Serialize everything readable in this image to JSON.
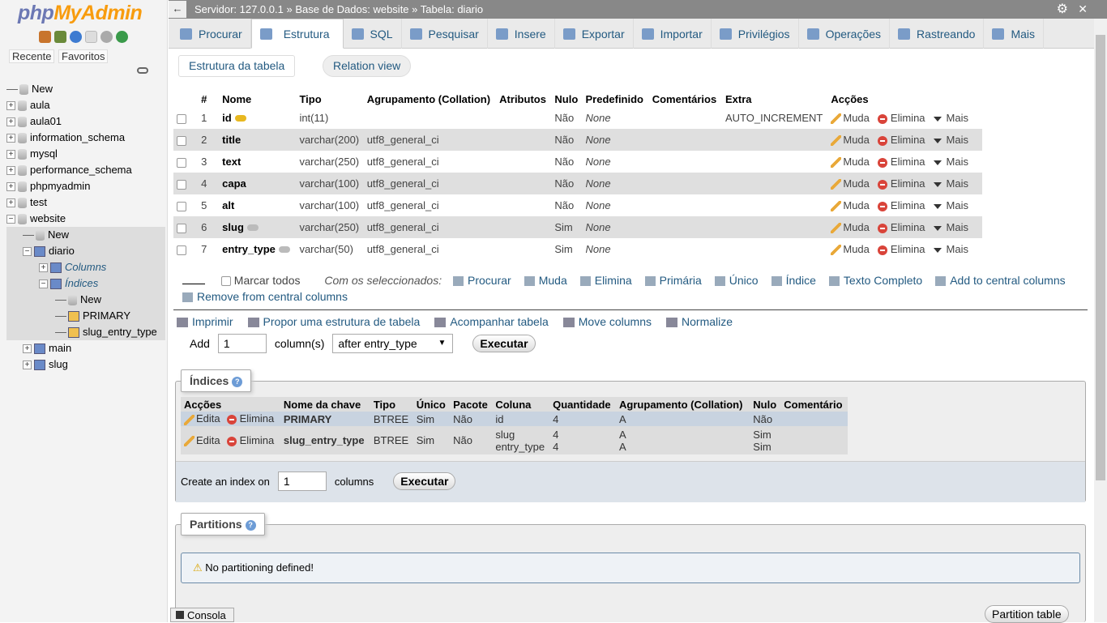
{
  "sidebar": {
    "logo": {
      "part1": "php",
      "part2": "MyAdmin"
    },
    "icons": [
      "home-icon",
      "logout-icon",
      "help-icon",
      "docs-icon",
      "settings-icon",
      "reload-icon"
    ],
    "recent": "Recente",
    "favorites": "Favoritos",
    "tree": [
      {
        "label": "New",
        "level": 0,
        "type": "new"
      },
      {
        "label": "aula",
        "level": 0,
        "type": "db"
      },
      {
        "label": "aula01",
        "level": 0,
        "type": "db"
      },
      {
        "label": "information_schema",
        "level": 0,
        "type": "db"
      },
      {
        "label": "mysql",
        "level": 0,
        "type": "db"
      },
      {
        "label": "performance_schema",
        "level": 0,
        "type": "db"
      },
      {
        "label": "phpmyadmin",
        "level": 0,
        "type": "db"
      },
      {
        "label": "test",
        "level": 0,
        "type": "db"
      },
      {
        "label": "website",
        "level": 0,
        "type": "db",
        "expanded": true
      },
      {
        "label": "New",
        "level": 1,
        "type": "new"
      },
      {
        "label": "diario",
        "level": 1,
        "type": "table",
        "expanded": true
      },
      {
        "label": "Columns",
        "level": 2,
        "type": "folder"
      },
      {
        "label": "Índices",
        "level": 2,
        "type": "folder",
        "expanded": true
      },
      {
        "label": "New",
        "level": 3,
        "type": "new"
      },
      {
        "label": "PRIMARY",
        "level": 3,
        "type": "index"
      },
      {
        "label": "slug_entry_type",
        "level": 3,
        "type": "index"
      },
      {
        "label": "main",
        "level": 1,
        "type": "table"
      },
      {
        "label": "slug",
        "level": 1,
        "type": "table"
      }
    ]
  },
  "breadcrumb": {
    "server": "Servidor: 127.0.0.1",
    "db": "Base de Dados: website",
    "table": "Tabela: diario",
    "sep": "»"
  },
  "tabs": [
    "Procurar",
    "Estrutura",
    "SQL",
    "Pesquisar",
    "Insere",
    "Exportar",
    "Importar",
    "Privilégios",
    "Operações",
    "Rastreando",
    "Mais"
  ],
  "active_tab": "Estrutura",
  "subtabs": {
    "structure": "Estrutura da tabela",
    "relation": "Relation view"
  },
  "structure": {
    "headers": [
      "#",
      "Nome",
      "Tipo",
      "Agrupamento (Collation)",
      "Atributos",
      "Nulo",
      "Predefinido",
      "Comentários",
      "Extra",
      "Acções"
    ],
    "rows": [
      {
        "n": "1",
        "name": "id",
        "type": "int(11)",
        "collation": "",
        "null": "Não",
        "default": "None",
        "extra": "AUTO_INCREMENT",
        "key": "primary"
      },
      {
        "n": "2",
        "name": "title",
        "type": "varchar(200)",
        "collation": "utf8_general_ci",
        "null": "Não",
        "default": "None",
        "extra": ""
      },
      {
        "n": "3",
        "name": "text",
        "type": "varchar(250)",
        "collation": "utf8_general_ci",
        "null": "Não",
        "default": "None",
        "extra": ""
      },
      {
        "n": "4",
        "name": "capa",
        "type": "varchar(100)",
        "collation": "utf8_general_ci",
        "null": "Não",
        "default": "None",
        "extra": ""
      },
      {
        "n": "5",
        "name": "alt",
        "type": "varchar(100)",
        "collation": "utf8_general_ci",
        "null": "Não",
        "default": "None",
        "extra": ""
      },
      {
        "n": "6",
        "name": "slug",
        "type": "varchar(250)",
        "collation": "utf8_general_ci",
        "null": "Sim",
        "default": "None",
        "extra": "",
        "key": "index"
      },
      {
        "n": "7",
        "name": "entry_type",
        "type": "varchar(50)",
        "collation": "utf8_general_ci",
        "null": "Sim",
        "default": "None",
        "extra": "",
        "key": "index"
      }
    ],
    "actions": {
      "change": "Muda",
      "drop": "Elimina",
      "more": "Mais"
    }
  },
  "bulk": {
    "check_all": "Marcar todos",
    "with_selected": "Com os seleccionados:",
    "items": [
      "Procurar",
      "Muda",
      "Elimina",
      "Primária",
      "Único",
      "Índice",
      "Texto Completo",
      "Add to central columns",
      "Remove from central columns"
    ]
  },
  "tools": [
    "Imprimir",
    "Propor uma estrutura de tabela",
    "Acompanhar tabela",
    "Move columns",
    "Normalize"
  ],
  "add_column": {
    "label": "Add",
    "value": "1",
    "unit": "column(s)",
    "position": "after entry_type",
    "submit": "Executar"
  },
  "indexes": {
    "title": "Índices",
    "headers": [
      "Acções",
      "Nome da chave",
      "Tipo",
      "Único",
      "Pacote",
      "Coluna",
      "Quantidade",
      "Agrupamento (Collation)",
      "Nulo",
      "Comentário"
    ],
    "edit": "Edita",
    "drop": "Elimina",
    "rows": [
      {
        "name": "PRIMARY",
        "type": "BTREE",
        "unique": "Sim",
        "packed": "Não",
        "columns": [
          {
            "col": "id",
            "card": "4",
            "coll": "A",
            "null": "Não"
          }
        ]
      },
      {
        "name": "slug_entry_type",
        "type": "BTREE",
        "unique": "Sim",
        "packed": "Não",
        "columns": [
          {
            "col": "slug",
            "card": "4",
            "coll": "A",
            "null": "Sim"
          },
          {
            "col": "entry_type",
            "card": "4",
            "coll": "A",
            "null": "Sim"
          }
        ]
      }
    ],
    "create_label": "Create an index on",
    "create_value": "1",
    "create_unit": "columns",
    "submit": "Executar"
  },
  "partitions": {
    "title": "Partitions",
    "message": "No partitioning defined!",
    "button": "Partition table"
  },
  "console": "Consola"
}
